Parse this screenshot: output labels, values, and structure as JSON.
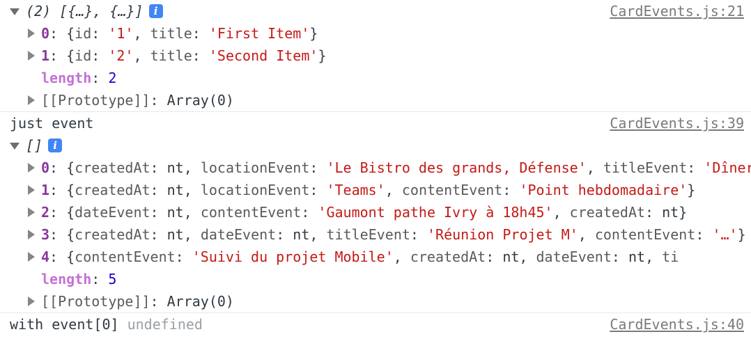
{
  "console": {
    "groups": [
      {
        "source_link": "CardEvents.js:21",
        "header": {
          "triangle": "open",
          "count": "(2)",
          "preview": " [{…}, {…}]",
          "info_badge": "i"
        },
        "rows": [
          {
            "indent": 1,
            "triangle": "closed",
            "key": "0",
            "tokens": [
              {
                "t": "punct",
                "v": ": {"
              },
              {
                "t": "prop",
                "v": "id"
              },
              {
                "t": "punct",
                "v": ": "
              },
              {
                "t": "str",
                "v": "'1'"
              },
              {
                "t": "punct",
                "v": ", "
              },
              {
                "t": "prop",
                "v": "title"
              },
              {
                "t": "punct",
                "v": ": "
              },
              {
                "t": "str",
                "v": "'First Item'"
              },
              {
                "t": "punct",
                "v": "}"
              }
            ]
          },
          {
            "indent": 1,
            "triangle": "closed",
            "key": "1",
            "tokens": [
              {
                "t": "punct",
                "v": ": {"
              },
              {
                "t": "prop",
                "v": "id"
              },
              {
                "t": "punct",
                "v": ": "
              },
              {
                "t": "str",
                "v": "'2'"
              },
              {
                "t": "punct",
                "v": ", "
              },
              {
                "t": "prop",
                "v": "title"
              },
              {
                "t": "punct",
                "v": ": "
              },
              {
                "t": "str",
                "v": "'Second Item'"
              },
              {
                "t": "punct",
                "v": "}"
              }
            ]
          },
          {
            "indent": 1,
            "triangle": "none",
            "length_key": "length",
            "tokens": [
              {
                "t": "punct",
                "v": ": "
              },
              {
                "t": "num",
                "v": "2"
              }
            ]
          },
          {
            "indent": 1,
            "triangle": "closed",
            "proto_key": "[[Prototype]]",
            "tokens": [
              {
                "t": "punct",
                "v": ": "
              },
              {
                "t": "arr0",
                "v": "Array(0)"
              }
            ]
          }
        ]
      },
      {
        "source_link": "CardEvents.js:39",
        "label": "just event",
        "header": {
          "triangle": "open",
          "count": "",
          "preview": "[]",
          "info_badge": "i"
        },
        "rows": [
          {
            "indent": 1,
            "triangle": "closed",
            "key": "0",
            "tokens": [
              {
                "t": "punct",
                "v": ": {"
              },
              {
                "t": "prop",
                "v": "createdAt"
              },
              {
                "t": "punct",
                "v": ": "
              },
              {
                "t": "nt",
                "v": "nt"
              },
              {
                "t": "punct",
                "v": ", "
              },
              {
                "t": "prop",
                "v": "locationEvent"
              },
              {
                "t": "punct",
                "v": ": "
              },
              {
                "t": "str",
                "v": "'Le Bistro des grands, Défense'"
              },
              {
                "t": "punct",
                "v": ", "
              },
              {
                "t": "prop",
                "v": "titleEvent"
              },
              {
                "t": "punct",
                "v": ": "
              },
              {
                "t": "str",
                "v": "'Dîner'"
              },
              {
                "t": "punct",
                "v": "}"
              }
            ]
          },
          {
            "indent": 1,
            "triangle": "closed",
            "key": "1",
            "tokens": [
              {
                "t": "punct",
                "v": ": {"
              },
              {
                "t": "prop",
                "v": "createdAt"
              },
              {
                "t": "punct",
                "v": ": "
              },
              {
                "t": "nt",
                "v": "nt"
              },
              {
                "t": "punct",
                "v": ", "
              },
              {
                "t": "prop",
                "v": "locationEvent"
              },
              {
                "t": "punct",
                "v": ": "
              },
              {
                "t": "str",
                "v": "'Teams'"
              },
              {
                "t": "punct",
                "v": ", "
              },
              {
                "t": "prop",
                "v": "contentEvent"
              },
              {
                "t": "punct",
                "v": ": "
              },
              {
                "t": "str",
                "v": "'Point hebdomadaire'"
              },
              {
                "t": "punct",
                "v": "}"
              }
            ]
          },
          {
            "indent": 1,
            "triangle": "closed",
            "key": "2",
            "tokens": [
              {
                "t": "punct",
                "v": ": {"
              },
              {
                "t": "prop",
                "v": "dateEvent"
              },
              {
                "t": "punct",
                "v": ": "
              },
              {
                "t": "nt",
                "v": "nt"
              },
              {
                "t": "punct",
                "v": ", "
              },
              {
                "t": "prop",
                "v": "contentEvent"
              },
              {
                "t": "punct",
                "v": ": "
              },
              {
                "t": "str",
                "v": "'Gaumont pathe Ivry à 18h45'"
              },
              {
                "t": "punct",
                "v": ", "
              },
              {
                "t": "prop",
                "v": "createdAt"
              },
              {
                "t": "punct",
                "v": ": "
              },
              {
                "t": "nt",
                "v": "nt"
              },
              {
                "t": "punct",
                "v": "}"
              }
            ]
          },
          {
            "indent": 1,
            "triangle": "closed",
            "key": "3",
            "tokens": [
              {
                "t": "punct",
                "v": ": {"
              },
              {
                "t": "prop",
                "v": "createdAt"
              },
              {
                "t": "punct",
                "v": ": "
              },
              {
                "t": "nt",
                "v": "nt"
              },
              {
                "t": "punct",
                "v": ", "
              },
              {
                "t": "prop",
                "v": "dateEvent"
              },
              {
                "t": "punct",
                "v": ": "
              },
              {
                "t": "nt",
                "v": "nt"
              },
              {
                "t": "punct",
                "v": ", "
              },
              {
                "t": "prop",
                "v": "titleEvent"
              },
              {
                "t": "punct",
                "v": ": "
              },
              {
                "t": "str",
                "v": "'Réunion Projet M'"
              },
              {
                "t": "punct",
                "v": ", "
              },
              {
                "t": "prop",
                "v": "contentEvent"
              },
              {
                "t": "punct",
                "v": ": "
              },
              {
                "t": "str",
                "v": "'…'"
              },
              {
                "t": "punct",
                "v": "}"
              }
            ]
          },
          {
            "indent": 1,
            "triangle": "closed",
            "key": "4",
            "tokens": [
              {
                "t": "punct",
                "v": ": {"
              },
              {
                "t": "prop",
                "v": "contentEvent"
              },
              {
                "t": "punct",
                "v": ": "
              },
              {
                "t": "str",
                "v": "'Suivi du projet Mobile'"
              },
              {
                "t": "punct",
                "v": ", "
              },
              {
                "t": "prop",
                "v": "createdAt"
              },
              {
                "t": "punct",
                "v": ": "
              },
              {
                "t": "nt",
                "v": "nt"
              },
              {
                "t": "punct",
                "v": ", "
              },
              {
                "t": "prop",
                "v": "dateEvent"
              },
              {
                "t": "punct",
                "v": ": "
              },
              {
                "t": "nt",
                "v": "nt"
              },
              {
                "t": "punct",
                "v": ", "
              },
              {
                "t": "prop",
                "v": "ti"
              },
              {
                "t": "punct",
                "v": ""
              }
            ]
          },
          {
            "indent": 1,
            "triangle": "none",
            "length_key": "length",
            "tokens": [
              {
                "t": "punct",
                "v": ": "
              },
              {
                "t": "num",
                "v": "5"
              }
            ]
          },
          {
            "indent": 1,
            "triangle": "closed",
            "proto_key": "[[Prototype]]",
            "tokens": [
              {
                "t": "punct",
                "v": ": "
              },
              {
                "t": "arr0",
                "v": "Array(0)"
              }
            ]
          }
        ]
      },
      {
        "source_link": "CardEvents.js:40",
        "label": "with event[0]",
        "value": "undefined",
        "rows": []
      }
    ]
  },
  "colors": {
    "string": "#c41a16",
    "number": "#1c00cf",
    "key": "#88379e",
    "length": "#c471d6",
    "prop": "#5a5a5a",
    "link": "#7a7a7a",
    "info_badge_bg": "#4285f4",
    "separator": "#e8e8e8",
    "text": "#303942",
    "dim": "#9aa0a6"
  }
}
